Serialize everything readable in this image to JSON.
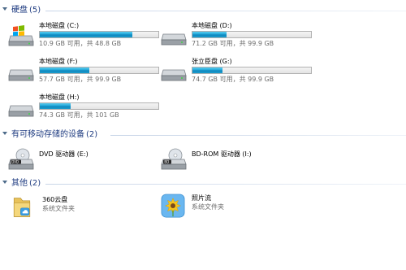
{
  "sections": {
    "hard_disks": {
      "title": "硬盘",
      "count": "(5)"
    },
    "removable": {
      "title": "有可移动存储的设备",
      "count": "(2)"
    },
    "other": {
      "title": "其他",
      "count": "(2)"
    }
  },
  "drives": [
    {
      "name": "本地磁盘 (C:)",
      "free_text": "10.9 GB 可用，共 48.8 GB",
      "used_fraction": 0.78,
      "icon": "windows-drive-icon"
    },
    {
      "name": "本地磁盘 (D:)",
      "free_text": "71.2 GB 可用，共 99.9 GB",
      "used_fraction": 0.29,
      "icon": "hard-drive-icon"
    },
    {
      "name": "本地磁盘 (F:)",
      "free_text": "57.7 GB 可用，共 99.9 GB",
      "used_fraction": 0.42,
      "icon": "hard-drive-icon"
    },
    {
      "name": "张立臣盘 (G:)",
      "free_text": "74.7 GB 可用，共 99.9 GB",
      "used_fraction": 0.25,
      "icon": "hard-drive-icon"
    },
    {
      "name": "本地磁盘 (H:)",
      "free_text": "74.3 GB 可用，共 101 GB",
      "used_fraction": 0.26,
      "icon": "hard-drive-icon"
    }
  ],
  "removable_devices": [
    {
      "name": "DVD 驱动器 (E:)",
      "icon": "dvd-drive-icon"
    },
    {
      "name": "BD-ROM 驱动器 (I:)",
      "icon": "bd-rom-drive-icon"
    }
  ],
  "other_items": [
    {
      "name": "360云盘",
      "sub": "系统文件夹",
      "icon": "cloud-folder-icon"
    },
    {
      "name": "照片流",
      "sub": "系统文件夹",
      "icon": "photo-stream-icon"
    }
  ],
  "colors": {
    "header_text": "#1e3b80",
    "bar_fill": "#1fa6d8",
    "sub_text": "#6d6d6d"
  }
}
